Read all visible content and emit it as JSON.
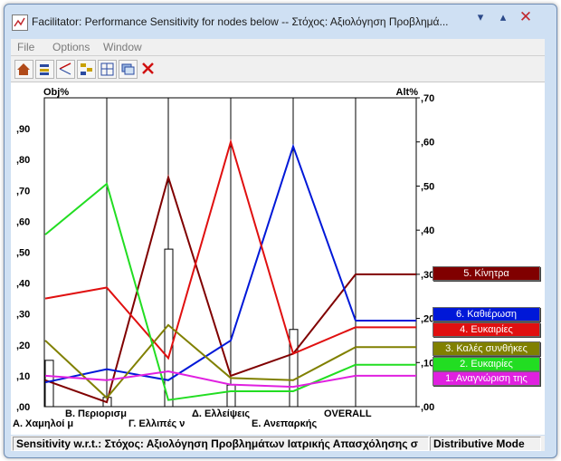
{
  "window": {
    "title": "Facilitator: Performance Sensitivity for nodes below -- Στόχος: Αξιολόγηση Προβλημά..."
  },
  "menu": [
    "File",
    "Options",
    "Window"
  ],
  "toolbar_icons": [
    "home-icon",
    "sort-icon",
    "split-icon",
    "tree-icon",
    "grid-icon",
    "windows-icon",
    "close-icon"
  ],
  "chart_data": {
    "type": "line",
    "left_axis_label": "Obj%",
    "right_axis_label": "Alt%",
    "left_ticks": [
      ",00",
      ",10",
      ",20",
      ",30",
      ",40",
      ",50",
      ",60",
      ",70",
      ",80",
      ",90"
    ],
    "right_ticks": [
      ",00",
      ",10",
      ",20",
      ",30",
      ",40",
      ",50",
      ",60",
      ",70"
    ],
    "left_range": [
      0,
      1.0
    ],
    "right_range": [
      0,
      0.7
    ],
    "criteria": [
      {
        "label": "Α. Χαμηλοί μ",
        "objective": 0.15
      },
      {
        "label": "Β. Περιορισμ",
        "objective": 0.03
      },
      {
        "label": "Γ. Ελλιπές ν",
        "objective": 0.51
      },
      {
        "label": "Δ. Ελλείψεις",
        "objective": 0.07
      },
      {
        "label": "Ε. Ανεπαρκής",
        "objective": 0.25
      },
      {
        "label": "OVERALL",
        "objective": null
      }
    ],
    "series": [
      {
        "name": "5. Κίνητρα",
        "color": "#800000",
        "values": [
          0.06,
          0.01,
          0.52,
          0.07,
          0.12,
          0.3
        ]
      },
      {
        "name": "6. Καθιέρωση",
        "color": "#0018d8",
        "values": [
          0.055,
          0.085,
          0.06,
          0.15,
          0.59,
          0.195
        ]
      },
      {
        "name": "4. Ευκαιρίες",
        "color": "#e01010",
        "values": [
          0.245,
          0.27,
          0.11,
          0.6,
          0.12,
          0.18
        ]
      },
      {
        "name": "3. Καλές συνθήκες",
        "color": "#808000",
        "values": [
          0.15,
          0.02,
          0.185,
          0.065,
          0.06,
          0.135
        ]
      },
      {
        "name": "2. Ευκαιρίες",
        "color": "#22dd22",
        "values": [
          0.39,
          0.505,
          0.015,
          0.035,
          0.035,
          0.095
        ]
      },
      {
        "name": "1. Αναγνώριση της",
        "color": "#e020e0",
        "values": [
          0.07,
          0.06,
          0.08,
          0.05,
          0.045,
          0.07
        ]
      }
    ]
  },
  "status": {
    "sensitivity": "Sensitivity w.r.t.: Στόχος: Αξιολόγηση Προβλημάτων Ιατρικής Απασχόλησης σ",
    "mode": "Distributive Mode"
  }
}
